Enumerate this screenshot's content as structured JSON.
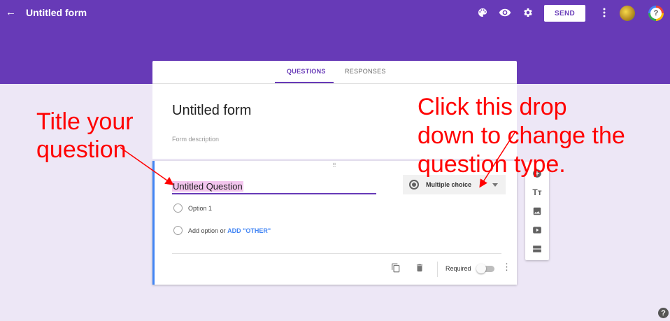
{
  "header": {
    "title": "Untitled form",
    "send_label": "SEND",
    "help_glyph": "?",
    "icons": [
      "back-arrow-icon",
      "palette-icon",
      "eye-icon",
      "gear-icon",
      "more-vert-icon",
      "avatar",
      "help-icon"
    ],
    "bg_color": "#673ab7"
  },
  "tabs": {
    "questions": "QUESTIONS",
    "responses": "RESPONSES",
    "active": "QUESTIONS"
  },
  "form": {
    "title": "Untitled form",
    "description_placeholder": "Form description"
  },
  "question": {
    "title": "Untitled Question",
    "type": "Multiple choice",
    "options": [
      "Option 1"
    ],
    "add_option": "Add option",
    "or": "or",
    "add_other": "ADD \"OTHER\"",
    "required_label": "Required",
    "required": false
  },
  "side_toolbar": {
    "items": [
      "add-question-icon",
      "title-text-icon",
      "image-icon",
      "video-icon",
      "section-icon"
    ],
    "title_glyph": "Tт"
  },
  "annotations": {
    "left_line1": "Title your",
    "left_line2": "question",
    "right_line1": "Click this drop",
    "right_line2": "down to change the",
    "right_line3": "question type.",
    "color": "#ff0000"
  },
  "footer": {
    "help_glyph": "?"
  }
}
